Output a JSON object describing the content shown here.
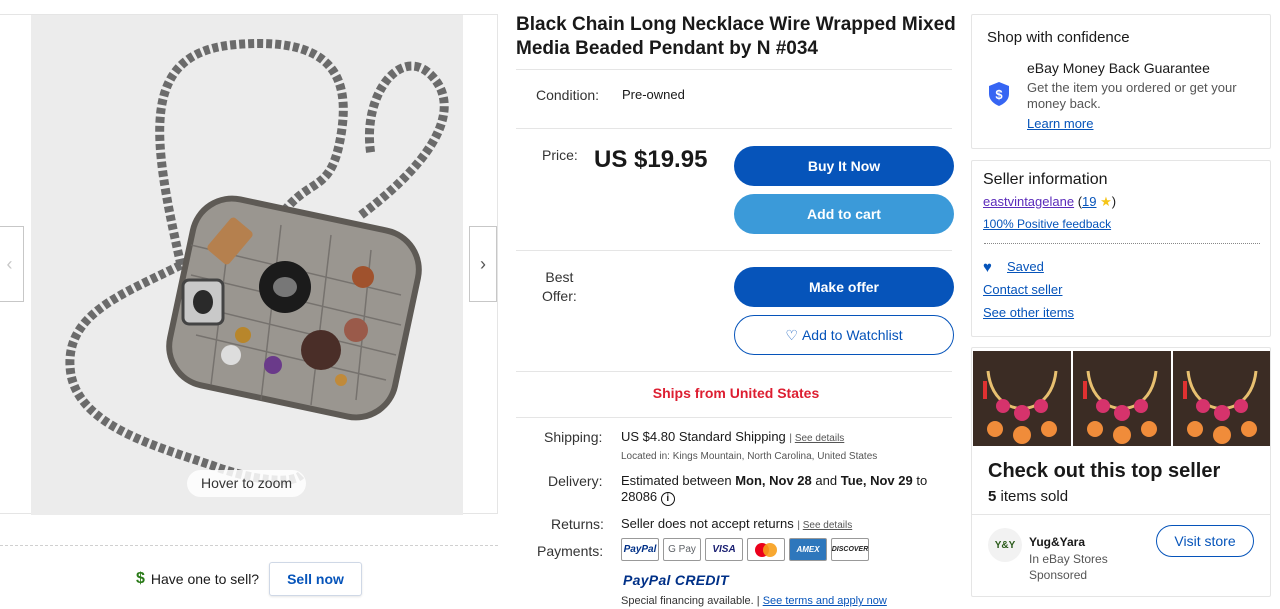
{
  "gallery": {
    "zoom_hint": "Hover to zoom",
    "prev_icon": "chevron-left-icon",
    "next_icon": "chevron-right-icon"
  },
  "sell": {
    "prompt": "Have one to sell?",
    "button": "Sell now"
  },
  "listing": {
    "title": "Black Chain Long Necklace Wire Wrapped Mixed Media Beaded Pendant by N #034",
    "condition_label": "Condition:",
    "condition_value": "Pre-owned",
    "price_label": "Price:",
    "price_value": "US $19.95",
    "buy_now": "Buy It Now",
    "add_to_cart": "Add to cart",
    "best_offer_label_1": "Best",
    "best_offer_label_2": "Offer:",
    "make_offer": "Make offer",
    "add_to_watchlist": "Add to Watchlist",
    "ships_from": "Ships from United States",
    "shipping_label": "Shipping:",
    "shipping_value": "US $4.80 Standard Shipping",
    "see_details": "See details",
    "located_in": "Located in: Kings Mountain, North Carolina, United States",
    "delivery_label": "Delivery:",
    "delivery_prefix": "Estimated between",
    "delivery_start": "Mon, Nov 28",
    "delivery_and": "and",
    "delivery_end": "Tue, Nov 29",
    "delivery_to": "to",
    "delivery_zip": "28086",
    "returns_label": "Returns:",
    "returns_value": "Seller does not accept returns",
    "payments_label": "Payments:",
    "payment_badges": [
      "PayPal",
      "G Pay",
      "VISA",
      "MC",
      "AMEX",
      "DISCOVER"
    ],
    "paypal_credit": "PayPal CREDIT",
    "financing_text": "Special financing available.",
    "financing_link": "See terms and apply now"
  },
  "confidence": {
    "title": "Shop with confidence",
    "guarantee_title": "eBay Money Back Guarantee",
    "guarantee_text": "Get the item you ordered or get your money back.",
    "learn_more": "Learn more"
  },
  "seller": {
    "title": "Seller information",
    "name": "eastvintagelane",
    "feedback_score": "19",
    "positive_feedback": "100% Positive feedback",
    "saved": "Saved",
    "contact": "Contact seller",
    "other_items": "See other items"
  },
  "promo": {
    "title": "Check out this top seller",
    "sold_count": "5",
    "sold_suffix": "items sold",
    "store_name": "Yug&Yara",
    "store_sub": "In eBay Stores",
    "sponsored": "Sponsored",
    "visit_store": "Visit store",
    "logo_text": "Y&Y"
  },
  "colors": {
    "primary_blue": "#0654ba",
    "light_blue": "#3b9ad9",
    "ships_red": "#dd1e31",
    "seller_purple": "#5b2bba"
  }
}
